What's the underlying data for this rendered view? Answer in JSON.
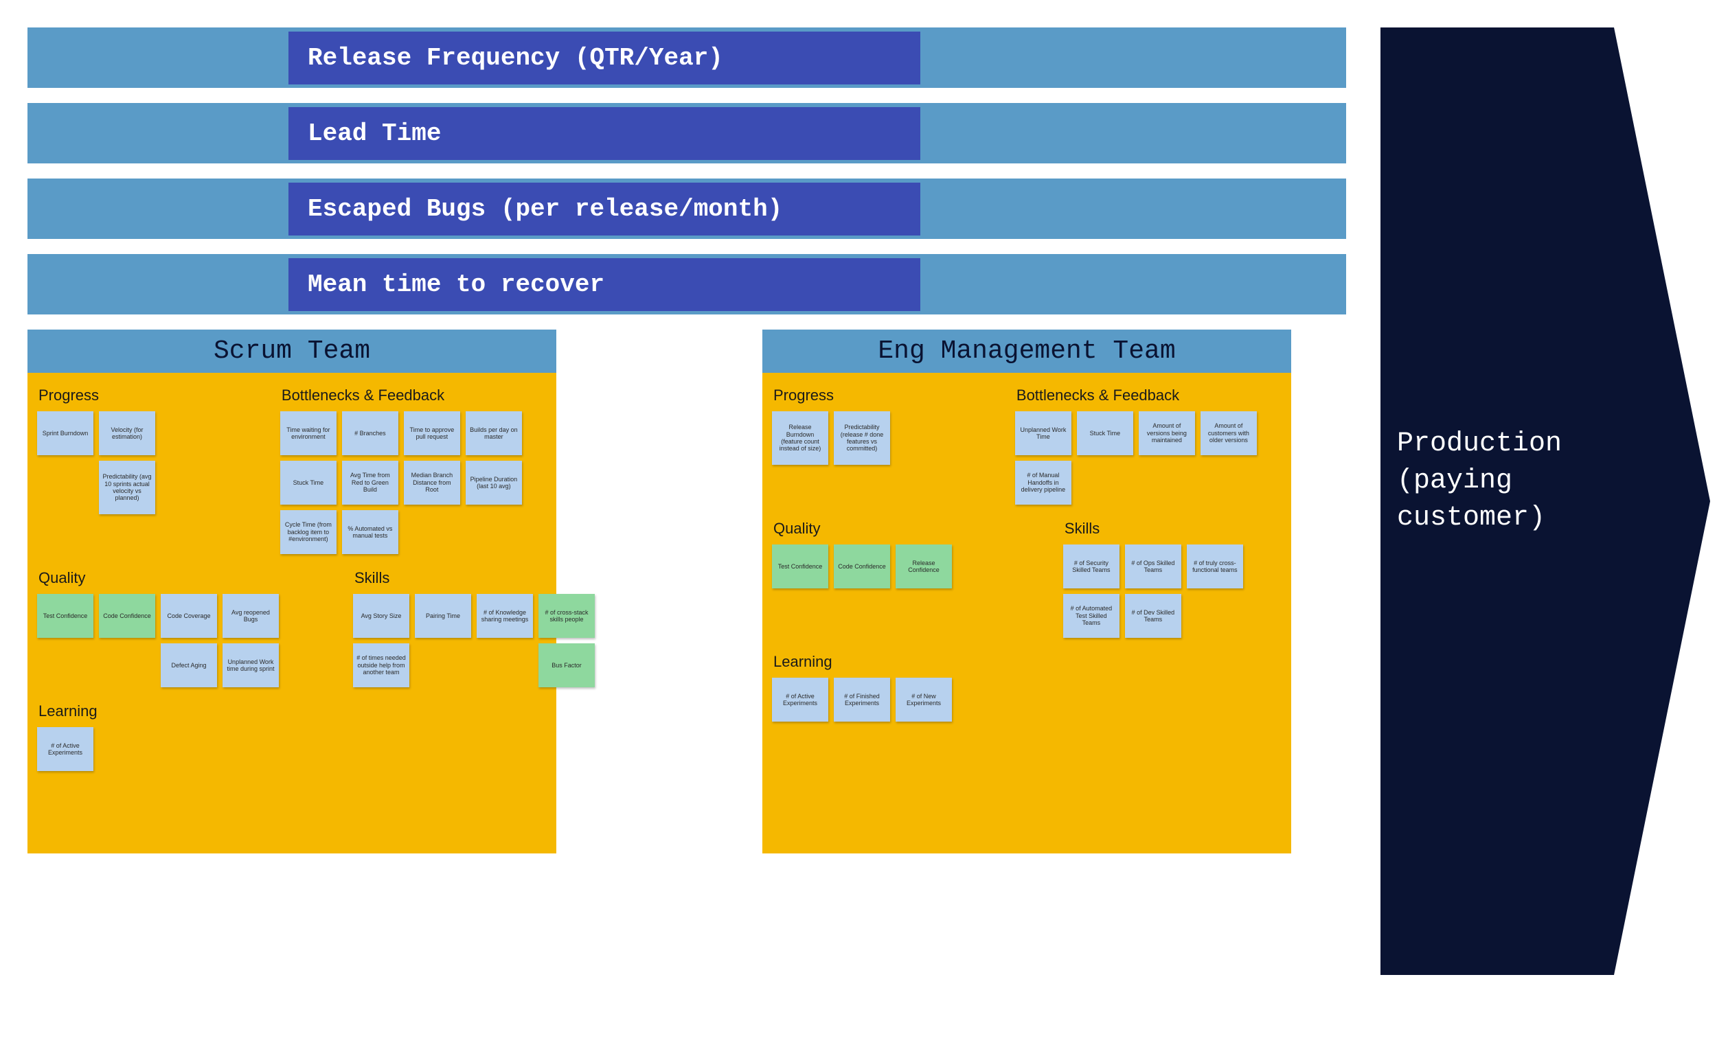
{
  "metrics": [
    "Release Frequency (QTR/Year)",
    "Lead Time",
    "Escaped Bugs (per release/month)",
    "Mean time to recover"
  ],
  "arrow_label": "Production (paying customer)",
  "boards": [
    {
      "title": "Scrum Team",
      "sections": {
        "progress": {
          "label": "Progress",
          "notes": [
            {
              "t": "Sprint Burndown",
              "c": "blue"
            },
            {
              "t": "Velocity (for estimation)",
              "c": "blue"
            },
            {
              "t": "Predictability (avg 10 sprints actual velocity vs planned)",
              "c": "blue",
              "big": true
            }
          ]
        },
        "bottlenecks": {
          "label": "Bottlenecks & Feedback",
          "notes": [
            {
              "t": "Time waiting for environment",
              "c": "blue"
            },
            {
              "t": "# Branches",
              "c": "blue"
            },
            {
              "t": "Time to approve pull request",
              "c": "blue"
            },
            {
              "t": "Builds per day on master",
              "c": "blue"
            },
            {
              "t": "Stuck Time",
              "c": "blue"
            },
            {
              "t": "Avg Time from Red to Green Build",
              "c": "blue"
            },
            {
              "t": "Median Branch Distance from Root",
              "c": "blue"
            },
            {
              "t": "Pipeline Duration (last 10 avg)",
              "c": "blue"
            },
            {
              "t": "Cycle Time (from backlog item to #environment)",
              "c": "blue"
            },
            {
              "t": "% Automated vs manual tests",
              "c": "blue"
            }
          ]
        },
        "quality": {
          "label": "Quality",
          "notes": [
            {
              "t": "Test Confidence",
              "c": "green"
            },
            {
              "t": "Code Confidence",
              "c": "green"
            },
            {
              "t": "Code Coverage",
              "c": "blue"
            },
            {
              "t": "Avg reopened Bugs",
              "c": "blue"
            },
            {
              "t": "Defect Aging",
              "c": "blue"
            },
            {
              "t": "Unplanned Work time during sprint",
              "c": "blue"
            }
          ]
        },
        "skills": {
          "label": "Skills",
          "notes": [
            {
              "t": "Avg Story Size",
              "c": "blue"
            },
            {
              "t": "Pairing Time",
              "c": "blue"
            },
            {
              "t": "# of Knowledge sharing meetings",
              "c": "blue"
            },
            {
              "t": "# of cross-stack skills people",
              "c": "green"
            },
            {
              "t": "# of times needed outside help from another team",
              "c": "blue"
            },
            {
              "t": "Bus Factor",
              "c": "green"
            }
          ]
        },
        "learning": {
          "label": "Learning",
          "notes": [
            {
              "t": "# of Active Experiments",
              "c": "blue"
            }
          ]
        }
      }
    },
    {
      "title": "Eng Management Team",
      "sections": {
        "progress": {
          "label": "Progress",
          "notes": [
            {
              "t": "Release Burndown (feature count instead of size)",
              "c": "blue",
              "big": true
            },
            {
              "t": "Predictability (release # done features vs committed)",
              "c": "blue",
              "big": true
            }
          ]
        },
        "bottlenecks": {
          "label": "Bottlenecks & Feedback",
          "notes": [
            {
              "t": "Unplanned Work Time",
              "c": "blue"
            },
            {
              "t": "Stuck Time",
              "c": "blue"
            },
            {
              "t": "Amount of versions being maintained",
              "c": "blue"
            },
            {
              "t": "Amount of customers with older versions",
              "c": "blue"
            },
            {
              "t": "# of Manual Handoffs in delivery pipeline",
              "c": "blue"
            }
          ]
        },
        "quality": {
          "label": "Quality",
          "notes": [
            {
              "t": "Test Confidence",
              "c": "green"
            },
            {
              "t": "Code Confidence",
              "c": "green"
            },
            {
              "t": "Release Confidence",
              "c": "green"
            }
          ]
        },
        "skills": {
          "label": "Skills",
          "notes": [
            {
              "t": "# of Security Skilled Teams",
              "c": "blue"
            },
            {
              "t": "# of Ops Skilled Teams",
              "c": "blue"
            },
            {
              "t": "# of truly cross-functional teams",
              "c": "blue"
            },
            {
              "t": "# of Automated Test Skilled Teams",
              "c": "blue"
            },
            {
              "t": "# of Dev Skilled Teams",
              "c": "blue"
            }
          ]
        },
        "learning": {
          "label": "Learning",
          "notes": [
            {
              "t": "# of Active Experiments",
              "c": "blue"
            },
            {
              "t": "# of Finished Experiments",
              "c": "blue"
            },
            {
              "t": "# of New Experiments",
              "c": "blue"
            }
          ]
        }
      }
    }
  ]
}
